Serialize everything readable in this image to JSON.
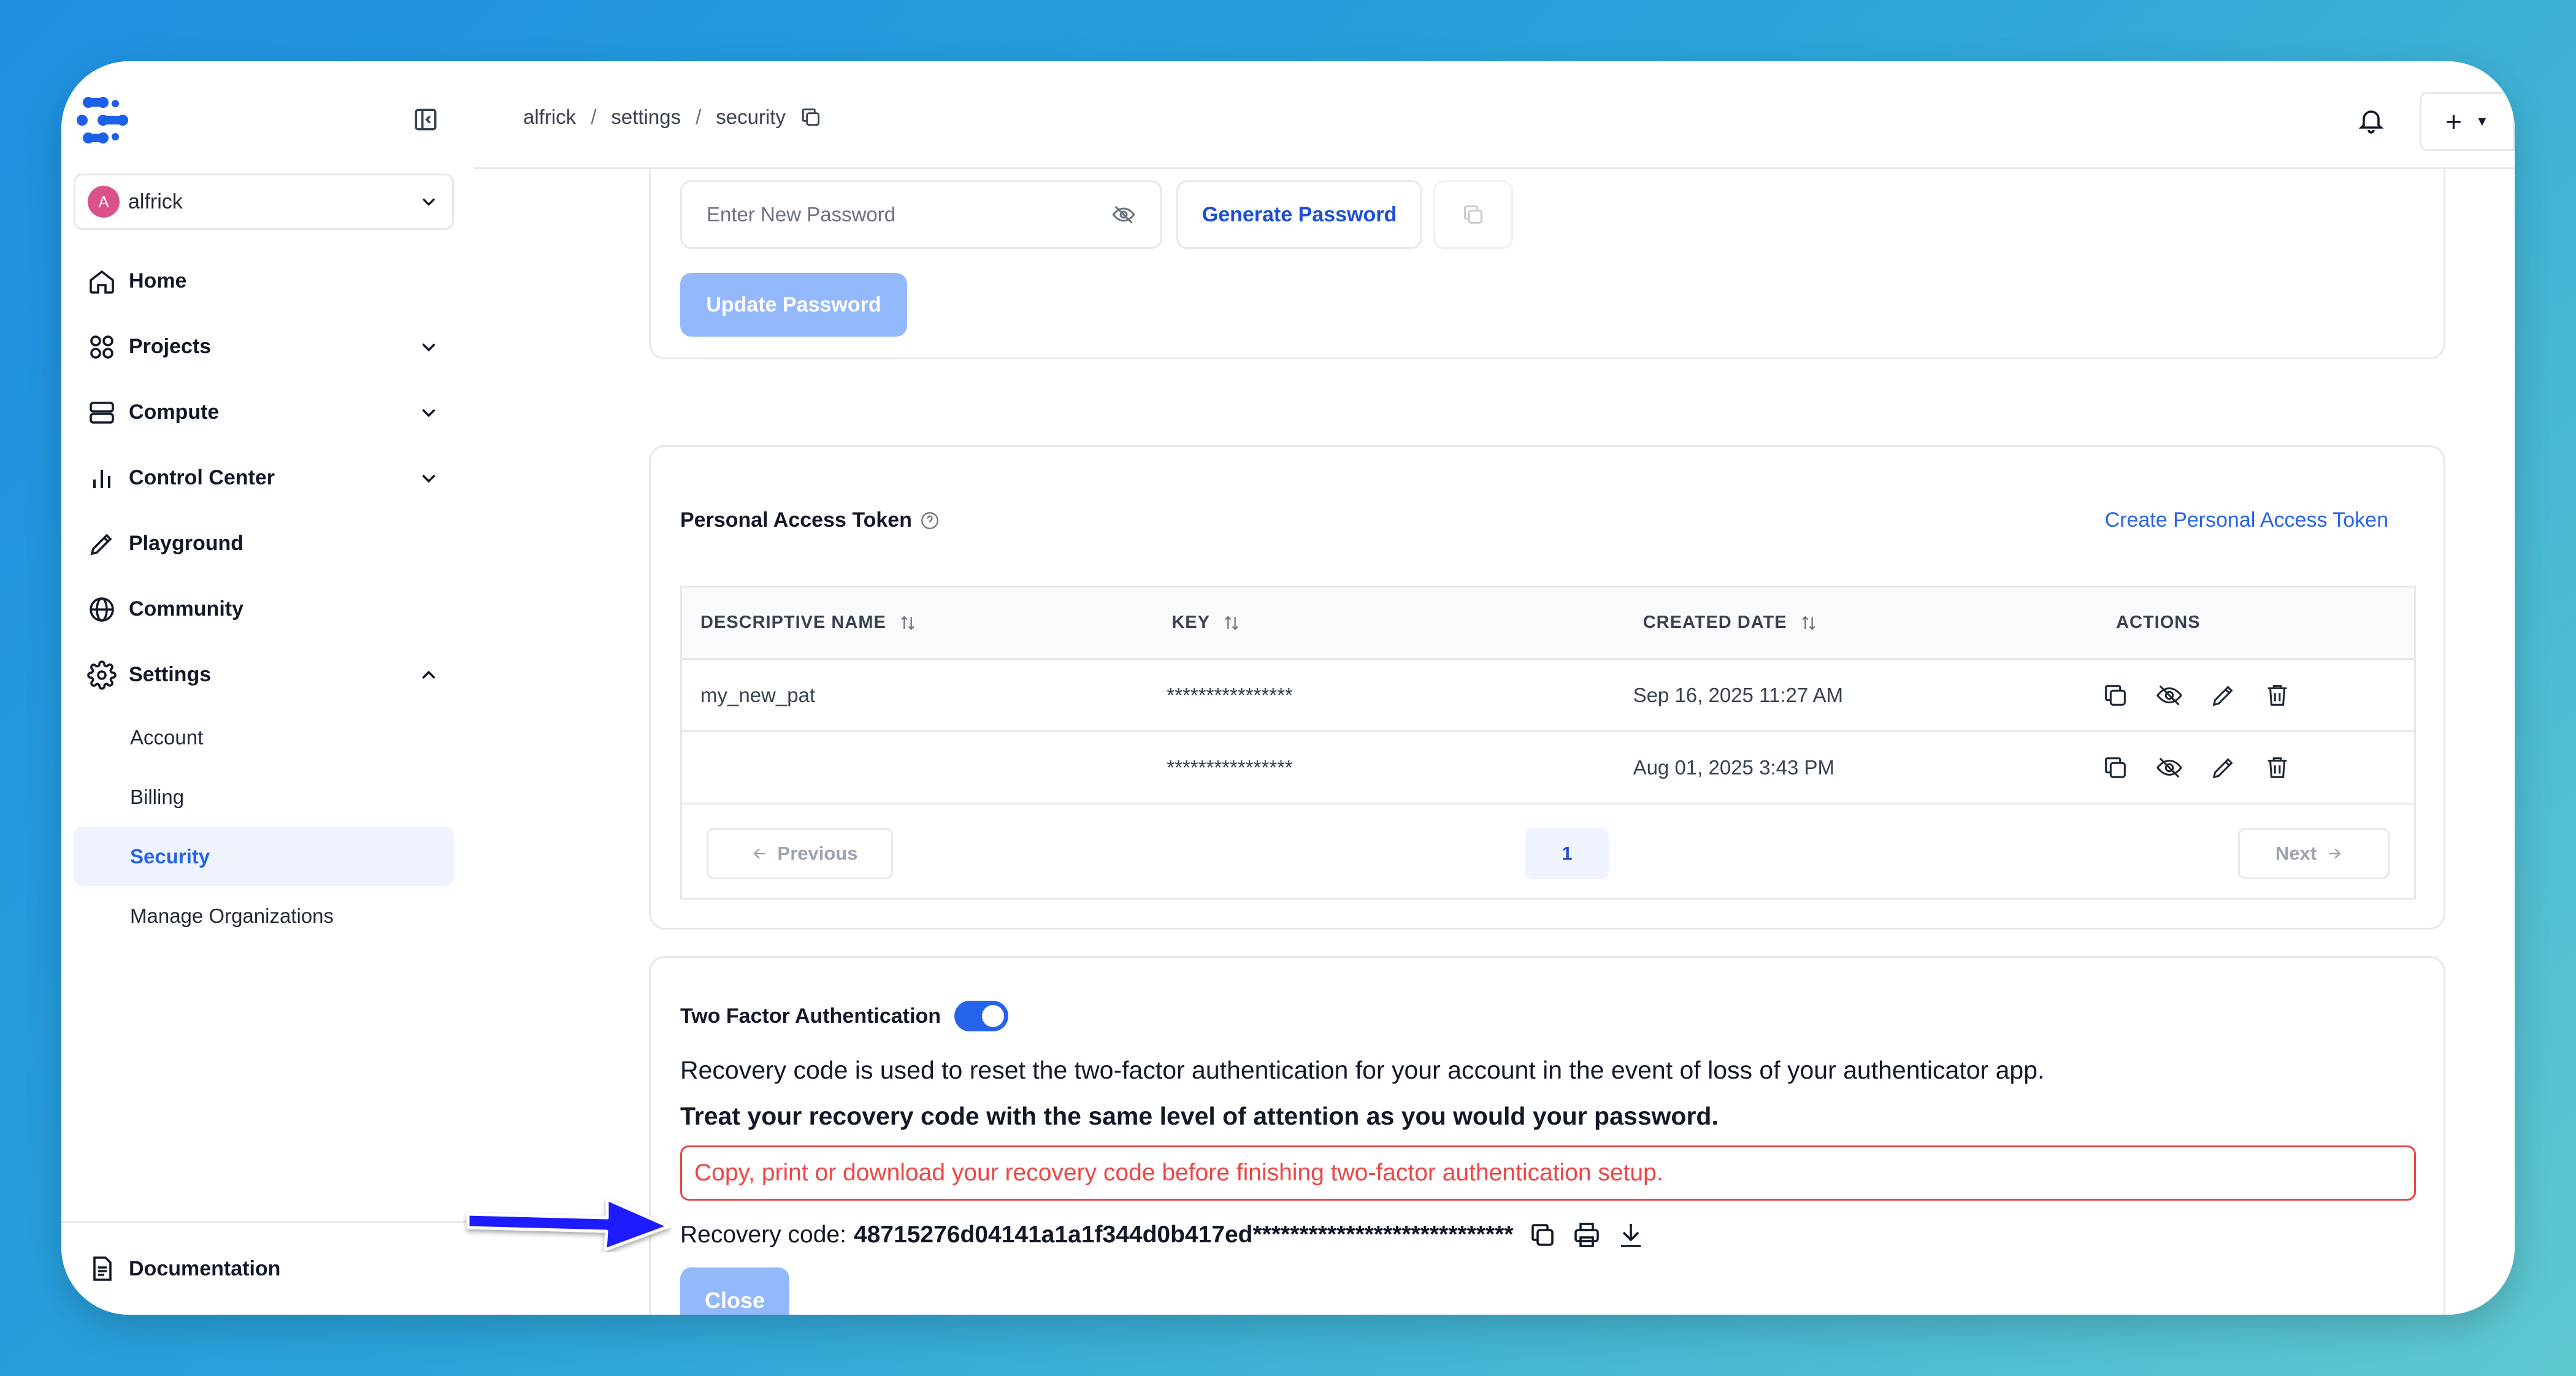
{
  "sidebar": {
    "org": {
      "avatar_letter": "A",
      "name": "alfrick"
    },
    "nav": [
      {
        "label": "Home",
        "icon": "home-icon"
      },
      {
        "label": "Projects",
        "icon": "grid-icon"
      },
      {
        "label": "Compute",
        "icon": "server-icon"
      },
      {
        "label": "Control Center",
        "icon": "bar-chart-icon"
      },
      {
        "label": "Playground",
        "icon": "pencil-icon"
      },
      {
        "label": "Community",
        "icon": "globe-icon"
      },
      {
        "label": "Settings",
        "icon": "gear-icon"
      }
    ],
    "settings_sub": [
      "Account",
      "Billing",
      "Security",
      "Manage Organizations"
    ],
    "active_sub": "Security",
    "documentation": "Documentation"
  },
  "topbar": {
    "breadcrumb": [
      "alfrick",
      "settings",
      "security"
    ],
    "add_label": "+"
  },
  "password": {
    "placeholder": "Enter New Password",
    "generate_label": "Generate Password",
    "update_label": "Update Password"
  },
  "pat": {
    "title": "Personal Access Token",
    "create_label": "Create Personal Access Token",
    "columns": [
      "DESCRIPTIVE NAME",
      "KEY",
      "CREATED DATE",
      "ACTIONS"
    ],
    "rows": [
      {
        "name": "my_new_pat",
        "key": "****************",
        "created": "Sep 16, 2025 11:27 AM"
      },
      {
        "name": "",
        "key": "****************",
        "created": "Aug 01, 2025 3:43 PM"
      }
    ],
    "pager": {
      "previous": "Previous",
      "page": "1",
      "next": "Next"
    }
  },
  "tfa": {
    "title": "Two Factor Authentication",
    "enabled": true,
    "description": "Recovery code is used to reset the two-factor authentication for your account in the event of loss of your authenticator app.",
    "warning": "Treat your recovery code with the same level of attention as you would your password.",
    "alert": "Copy, print or download your recovery code before finishing two-factor authentication setup.",
    "recovery_label": "Recovery code:",
    "recovery_code": "48715276d04141a1a1f344d0b417ed****************************",
    "close_label": "Close"
  },
  "colors": {
    "accent": "#2563eb",
    "button_disabled": "#93b8fb",
    "danger": "#ef4444",
    "active_bg": "#eef3fe",
    "annotation_arrow": "#1a1aff"
  }
}
